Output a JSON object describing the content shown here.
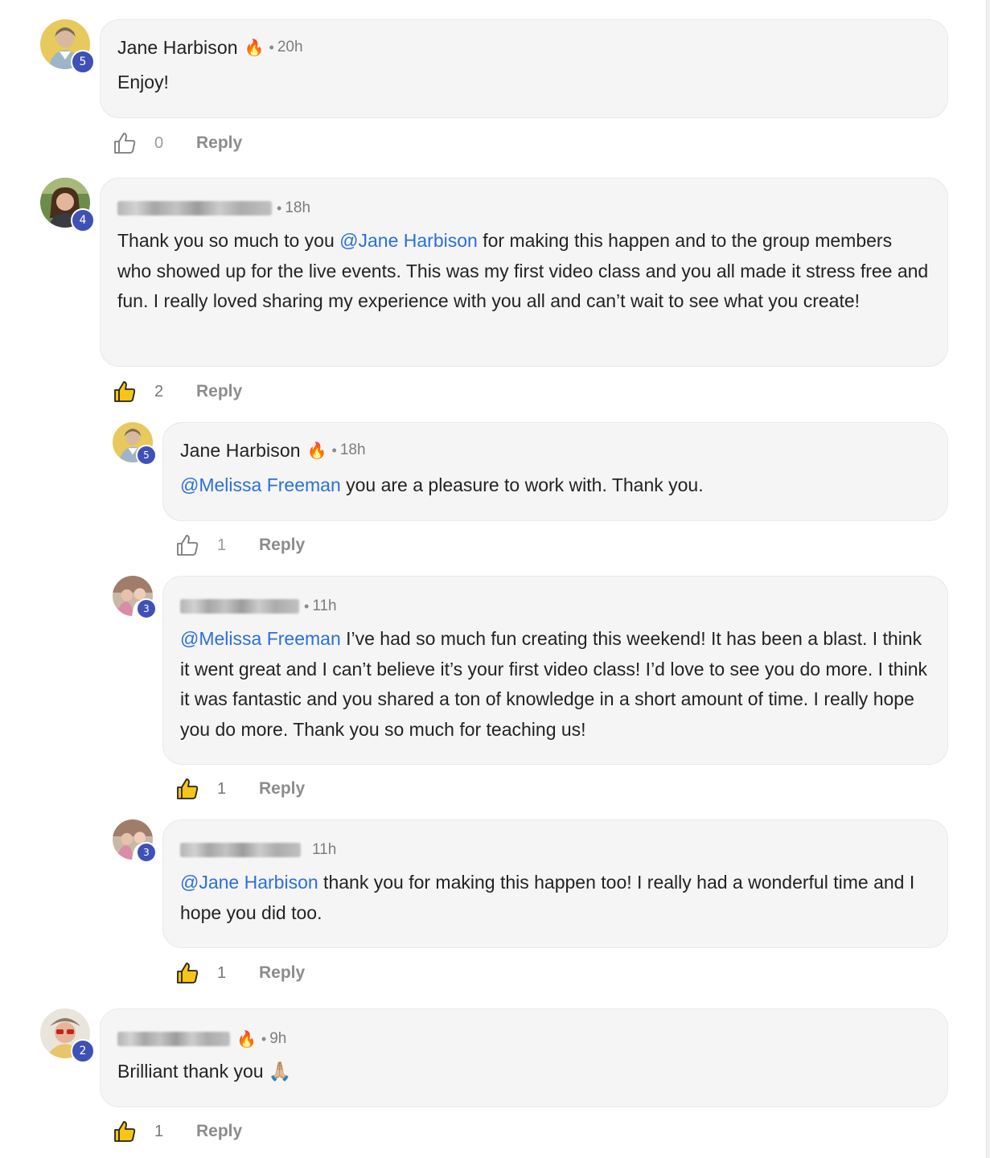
{
  "comments": [
    {
      "author": "Jane Harbison",
      "has_fire": true,
      "time": "20h",
      "level": "5",
      "avatar": "portrait-woman-gray-hair",
      "segments": [
        {
          "text": "Enjoy!"
        }
      ],
      "likes": "0",
      "liked": false,
      "reply_label": "Reply"
    },
    {
      "author": "",
      "author_blurred": true,
      "has_fire": false,
      "time": "18h",
      "level": "4",
      "avatar": "portrait-woman-brown-hair",
      "segments": [
        {
          "text": "Thank you so much to you "
        },
        {
          "text": "@Jane Harbison",
          "mention": true
        },
        {
          "text": " for making this happen and to the group members who showed up for the live events. This was my first video class and you all made it stress free and fun. I really loved sharing my experience with you all and can’t wait to see what you create!"
        }
      ],
      "likes": "2",
      "liked": true,
      "reply_label": "Reply"
    },
    {
      "author": "Jane Harbison",
      "has_fire": true,
      "time": "18h",
      "level": "5",
      "avatar": "portrait-woman-gray-hair",
      "segments": [
        {
          "text": "@Melissa Freeman",
          "mention": true
        },
        {
          "text": " you are a pleasure to work with. Thank you."
        }
      ],
      "likes": "1",
      "liked": false,
      "reply_label": "Reply"
    },
    {
      "author": "",
      "author_blurred": true,
      "has_fire": false,
      "time": "11h",
      "level": "3",
      "avatar": "portrait-group-pink",
      "segments": [
        {
          "text": "@Melissa Freeman",
          "mention": true
        },
        {
          "text": " I’ve had so much fun creating this weekend! It has been a blast. I think it went great and I can’t believe it’s your first video class! I’d love to see you do more. I think it was fantastic and you shared a ton of knowledge in a short amount of time. I really hope you do more. Thank you so much for teaching us!"
        }
      ],
      "likes": "1",
      "liked": true,
      "reply_label": "Reply"
    },
    {
      "author": "",
      "author_blurred": true,
      "has_fire": false,
      "time": "11h",
      "level": "3",
      "avatar": "portrait-group-pink",
      "segments": [
        {
          "text": "@Jane Harbison",
          "mention": true
        },
        {
          "text": " thank you for making this happen too! I really had a wonderful time and I hope you did too."
        }
      ],
      "likes": "1",
      "liked": true,
      "reply_label": "Reply"
    },
    {
      "author": "",
      "author_blurred": true,
      "has_fire": true,
      "time": "9h",
      "level": "2",
      "avatar": "portrait-person-sunglasses",
      "segments": [
        {
          "text": "Brilliant thank you 🙏🏼"
        }
      ],
      "likes": "1",
      "liked": true,
      "reply_label": "Reply"
    }
  ],
  "icons": {
    "like": "thumbs-up-icon",
    "fire": "🔥",
    "separator": "•"
  },
  "colors": {
    "mention": "#2d6fd9",
    "level_badge": "#3f51b5",
    "bubble": "#f5f5f5",
    "liked_fill": "#f5c518"
  }
}
